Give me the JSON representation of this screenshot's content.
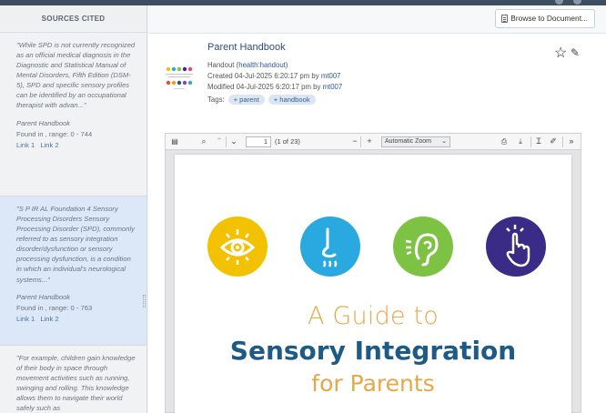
{
  "sidebar": {
    "header": "SOURCES CITED",
    "sources": [
      {
        "quote": "\"While SPD is not currently recognized as an official medical diagnosis in the Diagnostic and Statistical Manual of Mental Disorders, Fifth Edition (DSM-5), SPD and specific sensory profiles can be identified by an occupational therapist with advan...\"",
        "doc": "Parent Handbook",
        "found": "Found in , range: 0 - 744",
        "link1": "Link 1",
        "link2": "Link 2"
      },
      {
        "quote": "\"S P IR AL Foundation 4 Sensory Processing Disorders Sensory Processing Disorder (SPD), commonly referred to as sensory integration disorder/dysfunction or sensory processing dysfunction, is a condition in which an individual's neurological systems...\"",
        "doc": "Parent Handbook",
        "found": "Found in , range: 0 - 763",
        "link1": "Link 1",
        "link2": "Link 2"
      },
      {
        "quote": "\"For example, children gain knowledge of their body in space through movement activities such as running, swinging and rolling. This knowledge allows them to navigate their world safely such as"
      }
    ]
  },
  "main": {
    "browse_label": "Browse to Document...",
    "title": "Parent Handbook",
    "meta": {
      "type_prefix": "Handout (",
      "type_link": "health:handout",
      "type_suffix": ")",
      "created_prefix": "Created 04-Jul-2025 6:20:17 pm by ",
      "created_user": "mt007",
      "modified_prefix": "Modified 04-Jul-2025 6:20:17 pm by ",
      "modified_user": "mt007",
      "tags_label": "Tags:",
      "tags": [
        "+ parent",
        "+ handbook"
      ]
    }
  },
  "viewer": {
    "page_number": "1",
    "page_count": "(1 of 23)",
    "zoom": "Automatic Zoom",
    "page_content": {
      "line1": "A Guide to",
      "line2": "Sensory Integration",
      "line3": "for Parents"
    },
    "colors": {
      "sight": "#f2c200",
      "smell": "#2aa9e0",
      "hearing": "#7dc242",
      "touch": "#3a2b86"
    }
  }
}
